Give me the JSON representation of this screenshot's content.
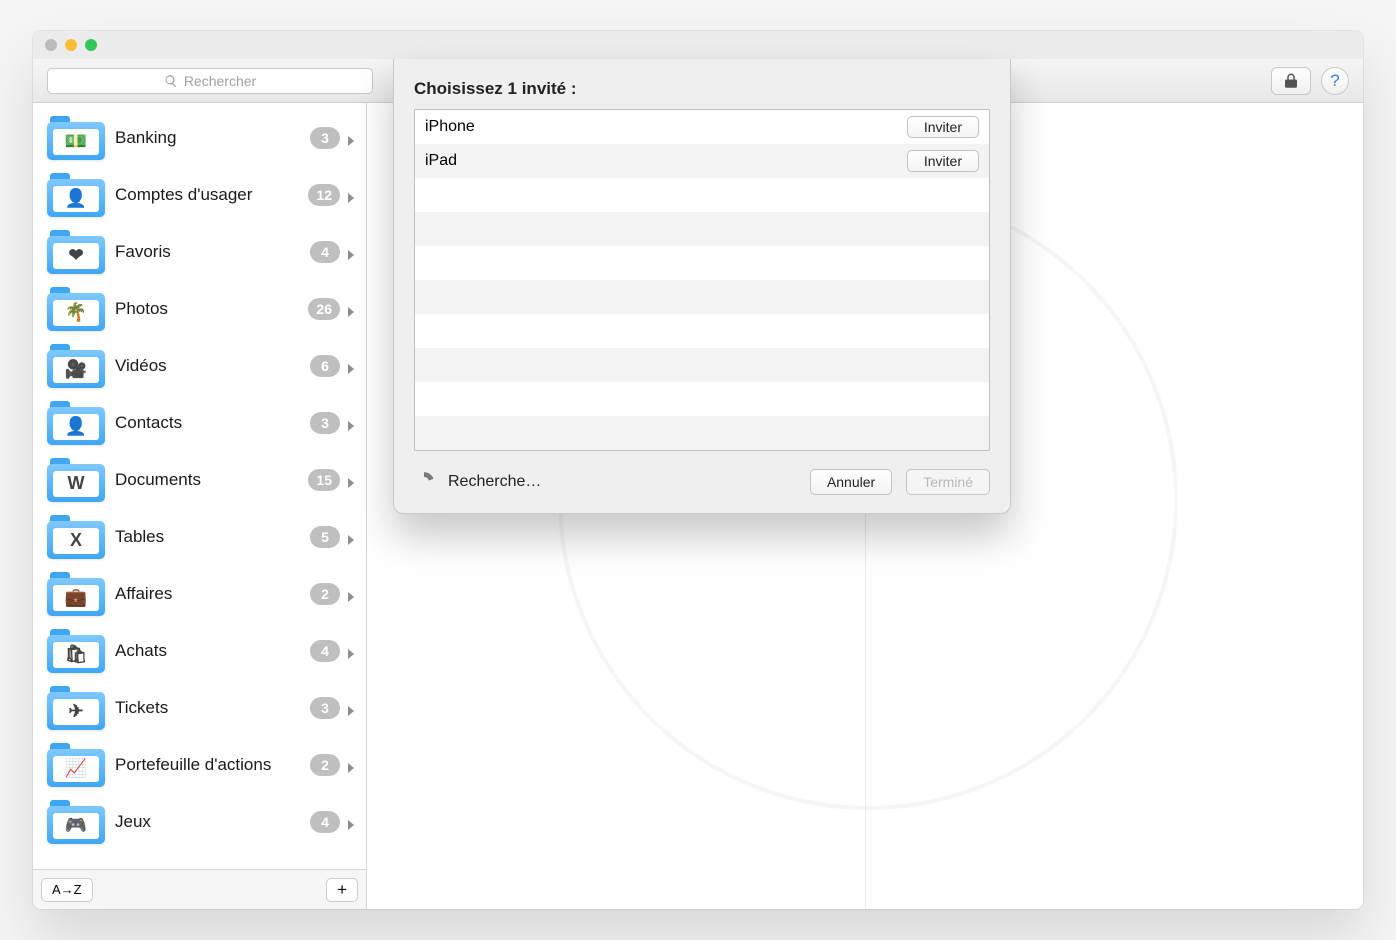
{
  "search": {
    "placeholder": "Rechercher"
  },
  "toolbar": {
    "lock_icon": "lock",
    "help_icon": "?"
  },
  "sidebar": {
    "items": [
      {
        "label": "Banking",
        "count": "3",
        "icon": "💵"
      },
      {
        "label": "Comptes d'usager",
        "count": "12",
        "icon": "👤"
      },
      {
        "label": "Favoris",
        "count": "4",
        "icon": "❤"
      },
      {
        "label": "Photos",
        "count": "26",
        "icon": "🌴"
      },
      {
        "label": "Vidéos",
        "count": "6",
        "icon": "🎥"
      },
      {
        "label": "Contacts",
        "count": "3",
        "icon": "👤"
      },
      {
        "label": "Documents",
        "count": "15",
        "icon": "W"
      },
      {
        "label": "Tables",
        "count": "5",
        "icon": "X"
      },
      {
        "label": "Affaires",
        "count": "2",
        "icon": "💼"
      },
      {
        "label": "Achats",
        "count": "4",
        "icon": "🛍"
      },
      {
        "label": "Tickets",
        "count": "3",
        "icon": "✈"
      },
      {
        "label": "Portefeuille d'actions",
        "count": "2",
        "icon": "📈"
      },
      {
        "label": "Jeux",
        "count": "4",
        "icon": "🎮"
      }
    ],
    "sort_label": "A→Z",
    "add_label": "+"
  },
  "dialog": {
    "title": "Choisissez 1 invité :",
    "rows": [
      {
        "name": "iPhone",
        "action": "Inviter"
      },
      {
        "name": "iPad",
        "action": "Inviter"
      }
    ],
    "empty_rows": 8,
    "status_text": "Recherche…",
    "cancel": "Annuler",
    "done": "Terminé"
  }
}
